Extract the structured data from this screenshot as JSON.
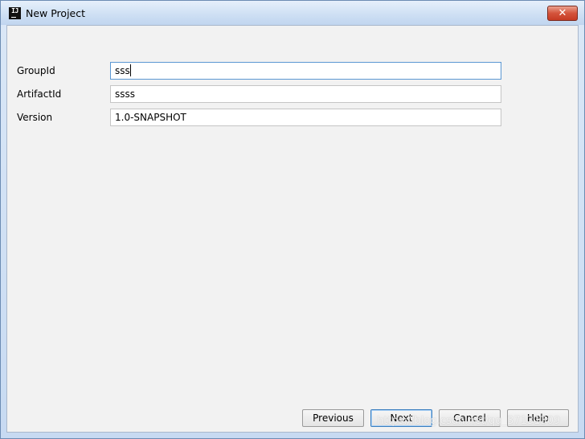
{
  "window": {
    "title": "New Project",
    "close_icon": "close-icon",
    "close_symbol": "✕"
  },
  "form": {
    "group_label": "GroupId",
    "group_value": "sss",
    "artifact_label": "ArtifactId",
    "artifact_value": "ssss",
    "version_label": "Version",
    "version_value": "1.0-SNAPSHOT"
  },
  "buttons": {
    "previous": "Previous",
    "next": "Next",
    "cancel": "Cancel",
    "help": "Help"
  },
  "watermark": "https://blog.csdn.net/qq_37131309",
  "colors": {
    "focus_border": "#5b97d3",
    "close_button": "#c63b24"
  }
}
